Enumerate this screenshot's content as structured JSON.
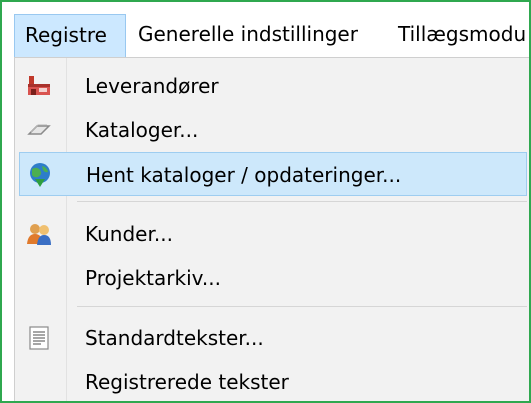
{
  "menubar": {
    "registre": "Registre",
    "generelle": "Generelle indstillinger",
    "tillaeg": "Tillægsmodu"
  },
  "menu": {
    "items": [
      {
        "label": "Leverandører",
        "icon": "supplier-icon"
      },
      {
        "label": "Kataloger...",
        "icon": "catalog-icon"
      },
      {
        "label": "Hent kataloger / opdateringer...",
        "icon": "globe-download-icon",
        "highlighted": true
      },
      {
        "label": "Kunder...",
        "icon": "customers-icon"
      },
      {
        "label": "Projektarkiv..."
      },
      {
        "label": "Standardtekster...",
        "icon": "document-text-icon"
      },
      {
        "label": "Registrerede tekster"
      }
    ]
  },
  "colors": {
    "frame": "#2fa84f",
    "highlight": "#cde8fb",
    "menu_background": "#f2f2f2"
  }
}
